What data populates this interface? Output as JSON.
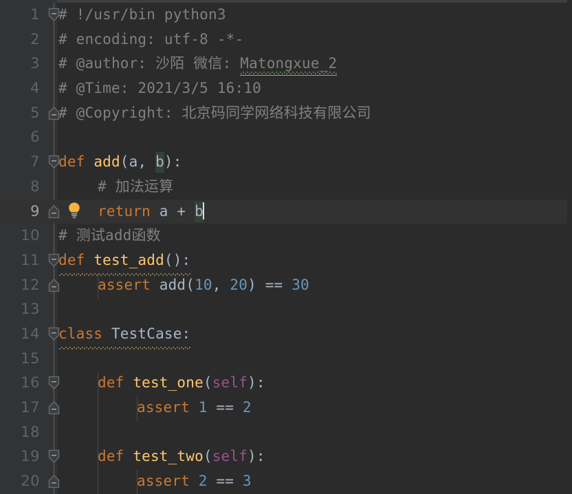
{
  "editor": {
    "app": "code-editor",
    "language": "python",
    "theme": "darcula",
    "colors": {
      "background": "#2b2b2b",
      "gutter_background": "#313335",
      "current_line": "#323232",
      "line_number": "#606366",
      "line_number_active": "#a4a3a3",
      "default_text": "#a9b7c6",
      "comment": "#808080",
      "keyword": "#cc7832",
      "function_name": "#ffc66d",
      "number": "#6897bb",
      "self_keyword": "#94558d",
      "identifier_highlight": "#344134",
      "warning_squiggle": "#8a7a3c",
      "typo_squiggle": "#5a7a4e",
      "caret": "#dcdcdc",
      "fold_line": "#606366",
      "indent_guide": "#4b4b4b",
      "bulb_icon": "#f5b53f"
    },
    "caret_line": 9,
    "caret_column": 18,
    "first_visible_line": 1,
    "last_visible_line": 20
  },
  "gutter": {
    "line_numbers": [
      "1",
      "2",
      "3",
      "4",
      "5",
      "6",
      "7",
      "8",
      "9",
      "10",
      "11",
      "12",
      "13",
      "14",
      "15",
      "16",
      "17",
      "18",
      "19",
      "20"
    ],
    "fold_markers": [
      {
        "line": 1,
        "type": "fold-start"
      },
      {
        "line": 5,
        "type": "fold-end"
      },
      {
        "line": 7,
        "type": "fold-start"
      },
      {
        "line": 9,
        "type": "fold-end"
      },
      {
        "line": 11,
        "type": "fold-start"
      },
      {
        "line": 12,
        "type": "fold-end"
      },
      {
        "line": 14,
        "type": "fold-start"
      },
      {
        "line": 16,
        "type": "fold-start"
      },
      {
        "line": 17,
        "type": "fold-end"
      },
      {
        "line": 19,
        "type": "fold-start"
      },
      {
        "line": 20,
        "type": "fold-end"
      }
    ],
    "intention_bulb": {
      "line": 9,
      "icon": "lightbulb-icon"
    }
  },
  "code": {
    "line1": "# !/usr/bin python3",
    "line2": "# encoding: utf-8 -*-",
    "line3_a": "# @author: 沙陌 微信: ",
    "line3_b": "Matongxue_2",
    "line4": "# @Time: 2021/3/5 16:10",
    "line5": "# @Copyright: 北京码同学网络科技有限公司",
    "line6": "",
    "line7_kw": "def",
    "line7_fn": "add",
    "line7_p1": "(a, ",
    "line7_p2": "b",
    "line7_p3": "):",
    "line8": "# 加法运算",
    "line9_kw": "return",
    "line9_a": " a + ",
    "line9_b": "b",
    "line10": "# 测试add函数",
    "line11_kw": "def",
    "line11_fn": "test_add",
    "line11_tail": "():",
    "line12_kw": "assert",
    "line12_fn": "add",
    "line12_p1": "(",
    "line12_n1": "10",
    "line12_p2": ", ",
    "line12_n2": "20",
    "line12_p3": ") == ",
    "line12_n3": "30",
    "line13": "",
    "line14_kw": "class",
    "line14_cls": "TestCase",
    "line14_tail": ":",
    "line15": "",
    "line16_kw": "def",
    "line16_fn": "test_one",
    "line16_o1": "(",
    "line16_self": "self",
    "line16_o2": "):",
    "line17_kw": "assert",
    "line17_n1": "1",
    "line17_op": " == ",
    "line17_n2": "2",
    "line18": "",
    "line19_kw": "def",
    "line19_fn": "test_two",
    "line19_o1": "(",
    "line19_self": "self",
    "line19_o2": "):",
    "line20_kw": "assert",
    "line20_n1": "2",
    "line20_op": " == ",
    "line20_n2": "3"
  }
}
